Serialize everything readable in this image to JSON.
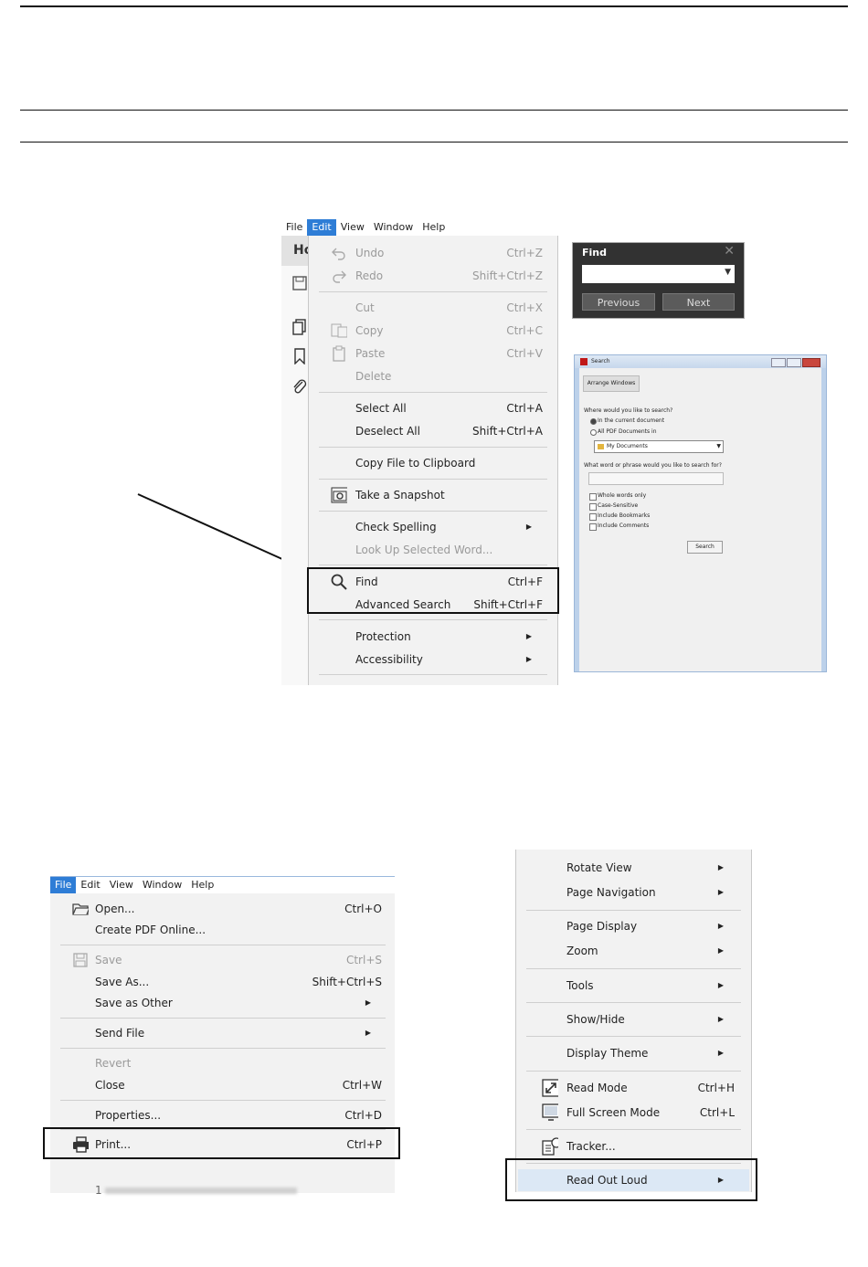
{
  "edit_menu": {
    "menubar": [
      "File",
      "Edit",
      "View",
      "Window",
      "Help"
    ],
    "active_index": 1,
    "behind_label": "Ho",
    "items": [
      {
        "label": "Undo",
        "shortcut": "Ctrl+Z",
        "disabled": true,
        "icon": "undo-icon"
      },
      {
        "label": "Redo",
        "shortcut": "Shift+Ctrl+Z",
        "disabled": true,
        "icon": "redo-icon"
      },
      {
        "label": "Cut",
        "shortcut": "Ctrl+X",
        "disabled": true
      },
      {
        "label": "Copy",
        "shortcut": "Ctrl+C",
        "disabled": true,
        "icon": "copy-icon"
      },
      {
        "label": "Paste",
        "shortcut": "Ctrl+V",
        "disabled": true,
        "icon": "paste-icon"
      },
      {
        "label": "Delete",
        "shortcut": "",
        "disabled": true
      },
      {
        "label": "Select All",
        "shortcut": "Ctrl+A"
      },
      {
        "label": "Deselect All",
        "shortcut": "Shift+Ctrl+A"
      },
      {
        "label": "Copy File to Clipboard",
        "shortcut": ""
      },
      {
        "label": "Take a Snapshot",
        "shortcut": "",
        "icon": "camera-icon"
      },
      {
        "label": "Check Spelling",
        "shortcut": "",
        "submenu": true
      },
      {
        "label": "Look Up Selected Word...",
        "shortcut": "",
        "disabled": true
      },
      {
        "label": "Find",
        "shortcut": "Ctrl+F",
        "icon": "search-icon"
      },
      {
        "label": "Advanced Search",
        "shortcut": "Shift+Ctrl+F"
      },
      {
        "label": "Protection",
        "shortcut": "",
        "submenu": true
      },
      {
        "label": "Accessibility",
        "shortcut": "",
        "submenu": true
      }
    ]
  },
  "find_panel": {
    "title": "Find",
    "previous_label": "Previous",
    "next_label": "Next"
  },
  "search_window": {
    "title": "Search",
    "arrange_label": "Arrange Windows",
    "where_label": "Where would you like to search?",
    "option_current": "In the current document",
    "option_all": "All PDF Documents in",
    "folder": "My Documents",
    "phrase_label": "What word or phrase would you like to search for?",
    "checks": [
      "Whole words only",
      "Case-Sensitive",
      "Include Bookmarks",
      "Include Comments"
    ],
    "search_button": "Search"
  },
  "file_menu": {
    "menubar": [
      "File",
      "Edit",
      "View",
      "Window",
      "Help"
    ],
    "active_index": 0,
    "items": [
      {
        "label": "Open...",
        "shortcut": "Ctrl+O",
        "icon": "folder-open-icon"
      },
      {
        "label": "Create PDF Online...",
        "shortcut": ""
      },
      {
        "label": "Save",
        "shortcut": "Ctrl+S",
        "disabled": true,
        "icon": "save-icon"
      },
      {
        "label": "Save As...",
        "shortcut": "Shift+Ctrl+S"
      },
      {
        "label": "Save as Other",
        "shortcut": "",
        "submenu": true
      },
      {
        "label": "Send File",
        "shortcut": "",
        "submenu": true
      },
      {
        "label": "Revert",
        "shortcut": "",
        "disabled": true
      },
      {
        "label": "Close",
        "shortcut": "Ctrl+W"
      },
      {
        "label": "Properties...",
        "shortcut": "Ctrl+D"
      },
      {
        "label": "Print...",
        "shortcut": "Ctrl+P",
        "icon": "printer-icon"
      }
    ]
  },
  "view_menu": {
    "items": [
      {
        "label": "Rotate View",
        "shortcut": "",
        "submenu": true
      },
      {
        "label": "Page Navigation",
        "shortcut": "",
        "submenu": true
      },
      {
        "label": "Page Display",
        "shortcut": "",
        "submenu": true
      },
      {
        "label": "Zoom",
        "shortcut": "",
        "submenu": true
      },
      {
        "label": "Tools",
        "shortcut": "",
        "submenu": true
      },
      {
        "label": "Show/Hide",
        "shortcut": "",
        "submenu": true
      },
      {
        "label": "Display Theme",
        "shortcut": "",
        "submenu": true
      },
      {
        "label": "Read Mode",
        "shortcut": "Ctrl+H",
        "icon": "read-mode-icon"
      },
      {
        "label": "Full Screen Mode",
        "shortcut": "Ctrl+L",
        "icon": "full-screen-icon"
      },
      {
        "label": "Tracker...",
        "shortcut": "",
        "icon": "tracker-icon"
      },
      {
        "label": "Read Out Loud",
        "shortcut": "",
        "submenu": true
      }
    ]
  }
}
